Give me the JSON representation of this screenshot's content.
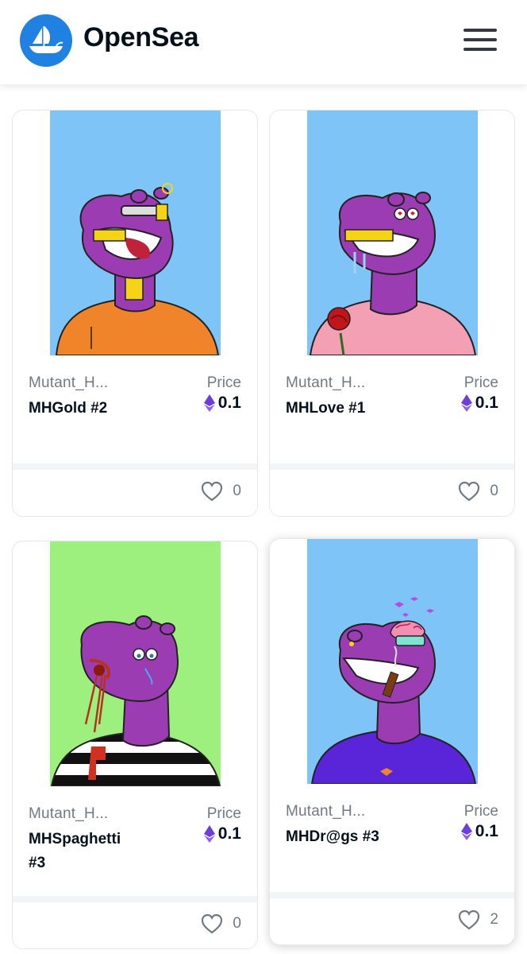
{
  "header": {
    "brand": "OpenSea",
    "logo_icon": "sailboat-icon",
    "menu_icon": "hamburger-menu-icon"
  },
  "colors": {
    "brand_blue": "#2081e2",
    "eth_purple": "#6c3fd8",
    "sky": "#7fc4f6",
    "mint": "#9ef07e"
  },
  "cards": [
    {
      "collection": "Mutant_H...",
      "name": "MHGold #2",
      "price_label": "Price",
      "price": "0.1",
      "likes": "0",
      "bg": "#7fc4f6",
      "shirt": "#f0842a"
    },
    {
      "collection": "Mutant_H...",
      "name": "MHLove #1",
      "price_label": "Price",
      "price": "0.1",
      "likes": "0",
      "bg": "#7fc4f6",
      "shirt": "#f3a0b4"
    },
    {
      "collection": "Mutant_H...",
      "name": "MHSpaghetti #3",
      "price_label": "Price",
      "price": "0.1",
      "likes": "0",
      "bg": "#9ef07e",
      "shirt": "stripes"
    },
    {
      "collection": "Mutant_H...",
      "name": "MHDr@gs #3",
      "price_label": "Price",
      "price": "0.1",
      "likes": "2",
      "bg": "#7fc4f6",
      "shirt": "#5a24d8"
    }
  ]
}
